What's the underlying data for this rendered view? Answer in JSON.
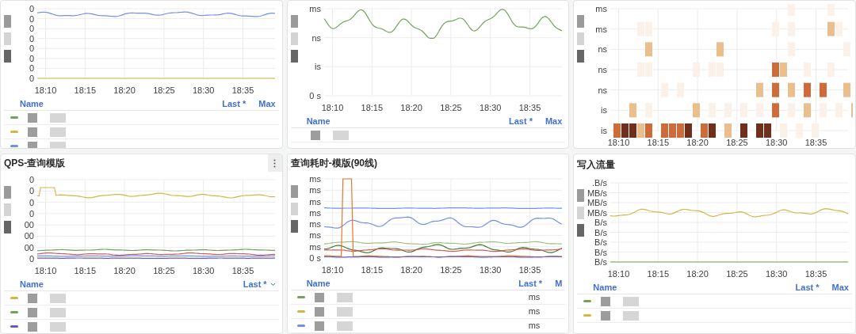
{
  "panels": [
    {
      "kind": "timeseries",
      "y_ticks": [
        "0",
        "0",
        "0",
        "0",
        "0",
        "0",
        "0",
        "0"
      ],
      "x_ticks": [
        "18:10",
        "18:15",
        "18:20",
        "18:25",
        "18:30",
        "18:35"
      ],
      "legend": {
        "columns": [
          "Name",
          "Last *",
          "Max"
        ],
        "sort_caret": false,
        "rows": [
          {
            "color": "#73a35b"
          },
          {
            "color": "#d6b545"
          },
          {
            "color": "#6f91e6"
          }
        ]
      }
    },
    {
      "kind": "timeseries",
      "y_ticks": [
        "ms",
        "ns",
        "is",
        "0 s"
      ],
      "x_ticks": [
        "18:10",
        "18:15",
        "18:20",
        "18:25",
        "18:30",
        "18:35"
      ],
      "legend": {
        "columns": [
          "Name",
          "Last *",
          "Max"
        ],
        "sort_caret": false,
        "rows": [
          {
            "swatch": false
          }
        ]
      }
    },
    {
      "kind": "heatmap",
      "y_ticks": [
        "ms",
        "ms",
        "ns",
        "ns",
        "ns",
        "is",
        "is"
      ],
      "x_ticks": [
        "18:10",
        "18:15",
        "18:20",
        "18:25",
        "18:30",
        "18:35"
      ]
    },
    {
      "kind": "timeseries",
      "title": "QPS-查询模版",
      "menu": true,
      "y_ticks": [
        "0",
        "0",
        "0",
        "0",
        "00",
        "00",
        "00",
        "0"
      ],
      "x_ticks": [
        "18:10",
        "18:15",
        "18:20",
        "18:25",
        "18:30",
        "18:35"
      ],
      "legend": {
        "columns": [
          "Name",
          "Last *"
        ],
        "sort_caret": true,
        "rows": [
          {
            "color": "#d6b545"
          },
          {
            "color": "#73a35b"
          },
          {
            "color": "#6a5fb0"
          }
        ]
      }
    },
    {
      "kind": "timeseries",
      "title": "查询耗时-模版(90线)",
      "y_ticks": [
        "ms",
        "ms",
        "ms",
        "ms",
        "ms",
        "ms",
        "ms",
        "0 s"
      ],
      "x_ticks": [
        "18:10",
        "18:15",
        "18:20",
        "18:25",
        "18:30",
        "18:35"
      ],
      "legend": {
        "columns": [
          "Name",
          "Last *",
          "M"
        ],
        "sort_caret": false,
        "rows": [
          {
            "color": "#73a35b",
            "value": "ms"
          },
          {
            "color": "#d6b545",
            "value": "ms"
          },
          {
            "color": "#6f91e6",
            "value": "ms"
          }
        ]
      }
    },
    {
      "kind": "timeseries",
      "title": "写入流量",
      "y_ticks": [
        ".B/s",
        "MB/s",
        "MB/s",
        "MB/s",
        "B/s",
        "B/s",
        "B/s",
        "B/s",
        "B/s"
      ],
      "x_ticks": [
        "18:10",
        "18:15",
        "18:20",
        "18:25",
        "18:30",
        "18:35"
      ],
      "legend": {
        "columns": [
          "Name",
          "Last *",
          "Max"
        ],
        "sort_caret": false,
        "rows": [
          {
            "color": "#73a35b"
          },
          {
            "color": "#d6b545"
          }
        ]
      }
    }
  ]
}
